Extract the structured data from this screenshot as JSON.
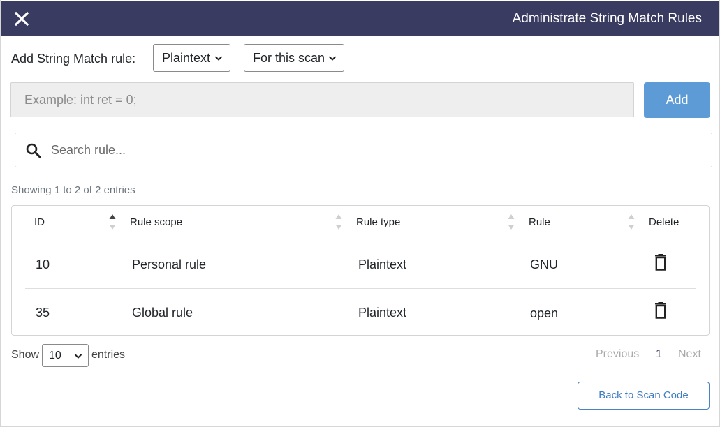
{
  "header": {
    "title": "Administrate String Match Rules",
    "close_icon": "close-icon"
  },
  "add_rule": {
    "label": "Add String Match rule:",
    "type_select": {
      "selected": "Plaintext"
    },
    "scope_select": {
      "selected": "For this scan"
    },
    "input_placeholder": "Example: int ret = 0;",
    "add_label": "Add"
  },
  "search": {
    "placeholder": "Search rule..."
  },
  "table": {
    "info": "Showing 1 to 2 of 2 entries",
    "columns": [
      "ID",
      "Rule scope",
      "Rule type",
      "Rule",
      "Delete"
    ],
    "rows": [
      {
        "id": "10",
        "scope": "Personal rule",
        "type": "Plaintext",
        "rule": "GNU"
      },
      {
        "id": "35",
        "scope": "Global rule",
        "type": "Plaintext",
        "rule": "open"
      }
    ]
  },
  "footer": {
    "show_label": "Show",
    "page_length": "10",
    "entries_label": "entries",
    "pagination": {
      "previous": "Previous",
      "current": "1",
      "next": "Next"
    },
    "back_label": "Back to Scan Code"
  },
  "colors": {
    "header_bg": "#3a3b61",
    "accent": "#5c9bd5",
    "link": "#3f7cc0"
  }
}
